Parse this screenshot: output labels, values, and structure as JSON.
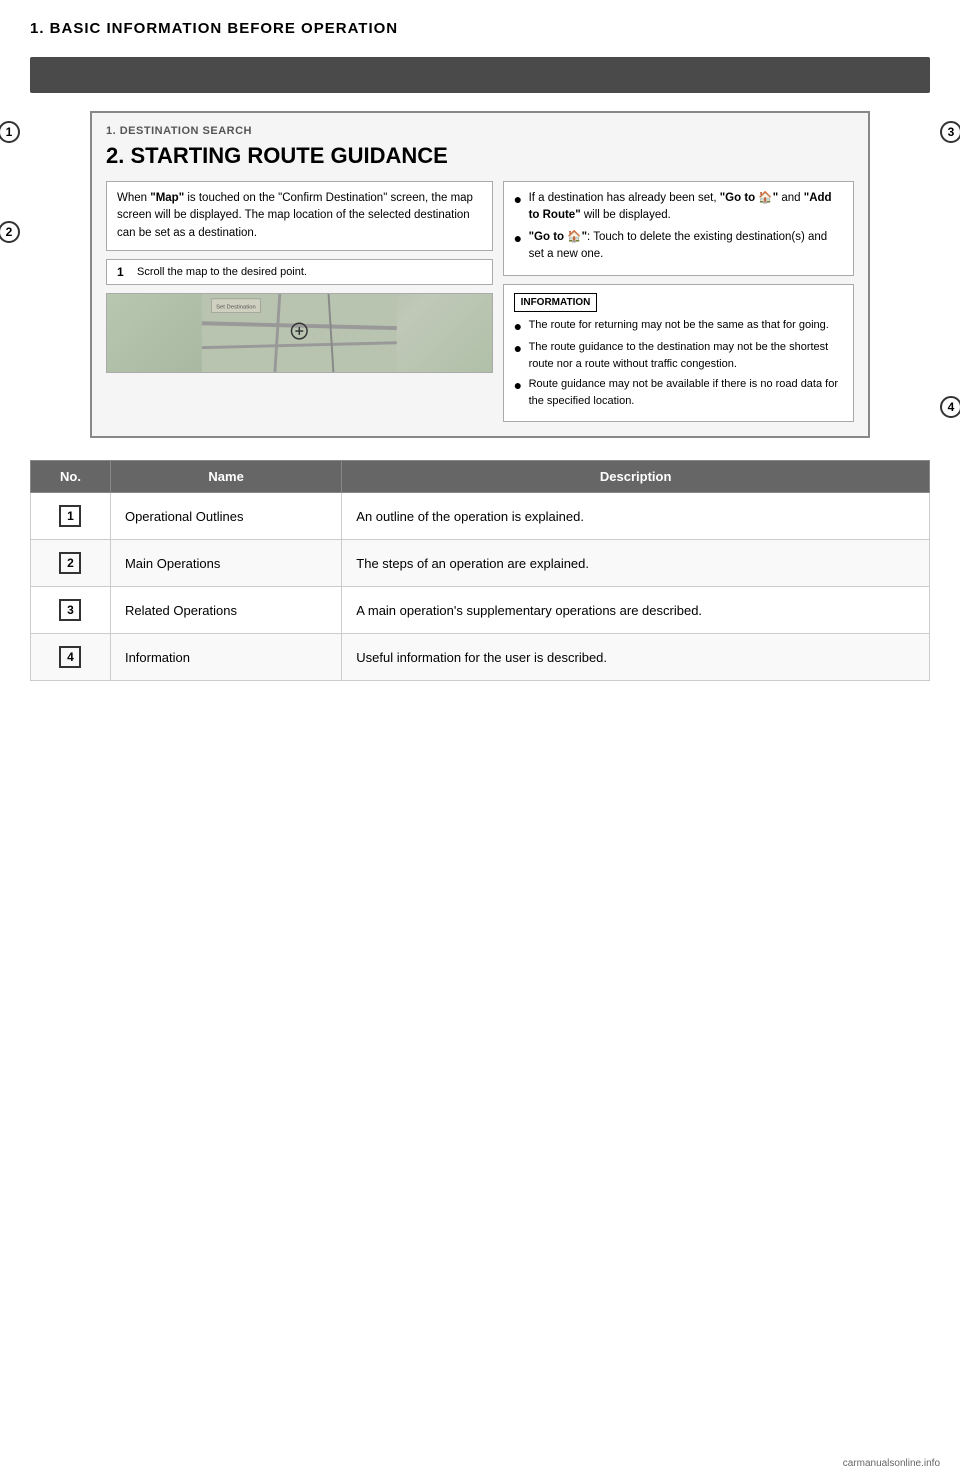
{
  "page": {
    "title": "1. BASIC INFORMATION BEFORE OPERATION",
    "diagram": {
      "section_header": "1. DESTINATION SEARCH",
      "section_title": "2. STARTING ROUTE GUIDANCE",
      "left_text_box": "When \"Map\" is touched on the \"Confirm Destination\" screen, the map screen will be displayed. The map location of the selected destination can be set as a destination.",
      "step_label": "1",
      "step_text": "Scroll the map to the desired point.",
      "map_alt": "Map screenshot",
      "right_bullet_1": "If a destination has already been set, \"Go to\" and \"Add to Route\" will be displayed.",
      "right_bullet_2": "\"Go to\": Touch to delete the existing destination(s) and set a new one.",
      "info_label": "INFORMATION",
      "info_bullet_1": "The route for returning may not be the same as that for going.",
      "info_bullet_2": "The route guidance to the destination may not be the shortest route nor a route without traffic congestion.",
      "info_bullet_3": "Route guidance may not be available if there is no road data for the specified location."
    },
    "table": {
      "headers": [
        "No.",
        "Name",
        "Description"
      ],
      "rows": [
        {
          "no": "1",
          "name": "Operational Outlines",
          "description": "An outline of the operation is explained."
        },
        {
          "no": "2",
          "name": "Main Operations",
          "description": "The steps of an operation are explained."
        },
        {
          "no": "3",
          "name": "Related Operations",
          "description": "A main operation's supplementary operations are described."
        },
        {
          "no": "4",
          "name": "Information",
          "description": "Useful information for the user is described."
        }
      ]
    },
    "footer": "carmanualsonline.info"
  }
}
